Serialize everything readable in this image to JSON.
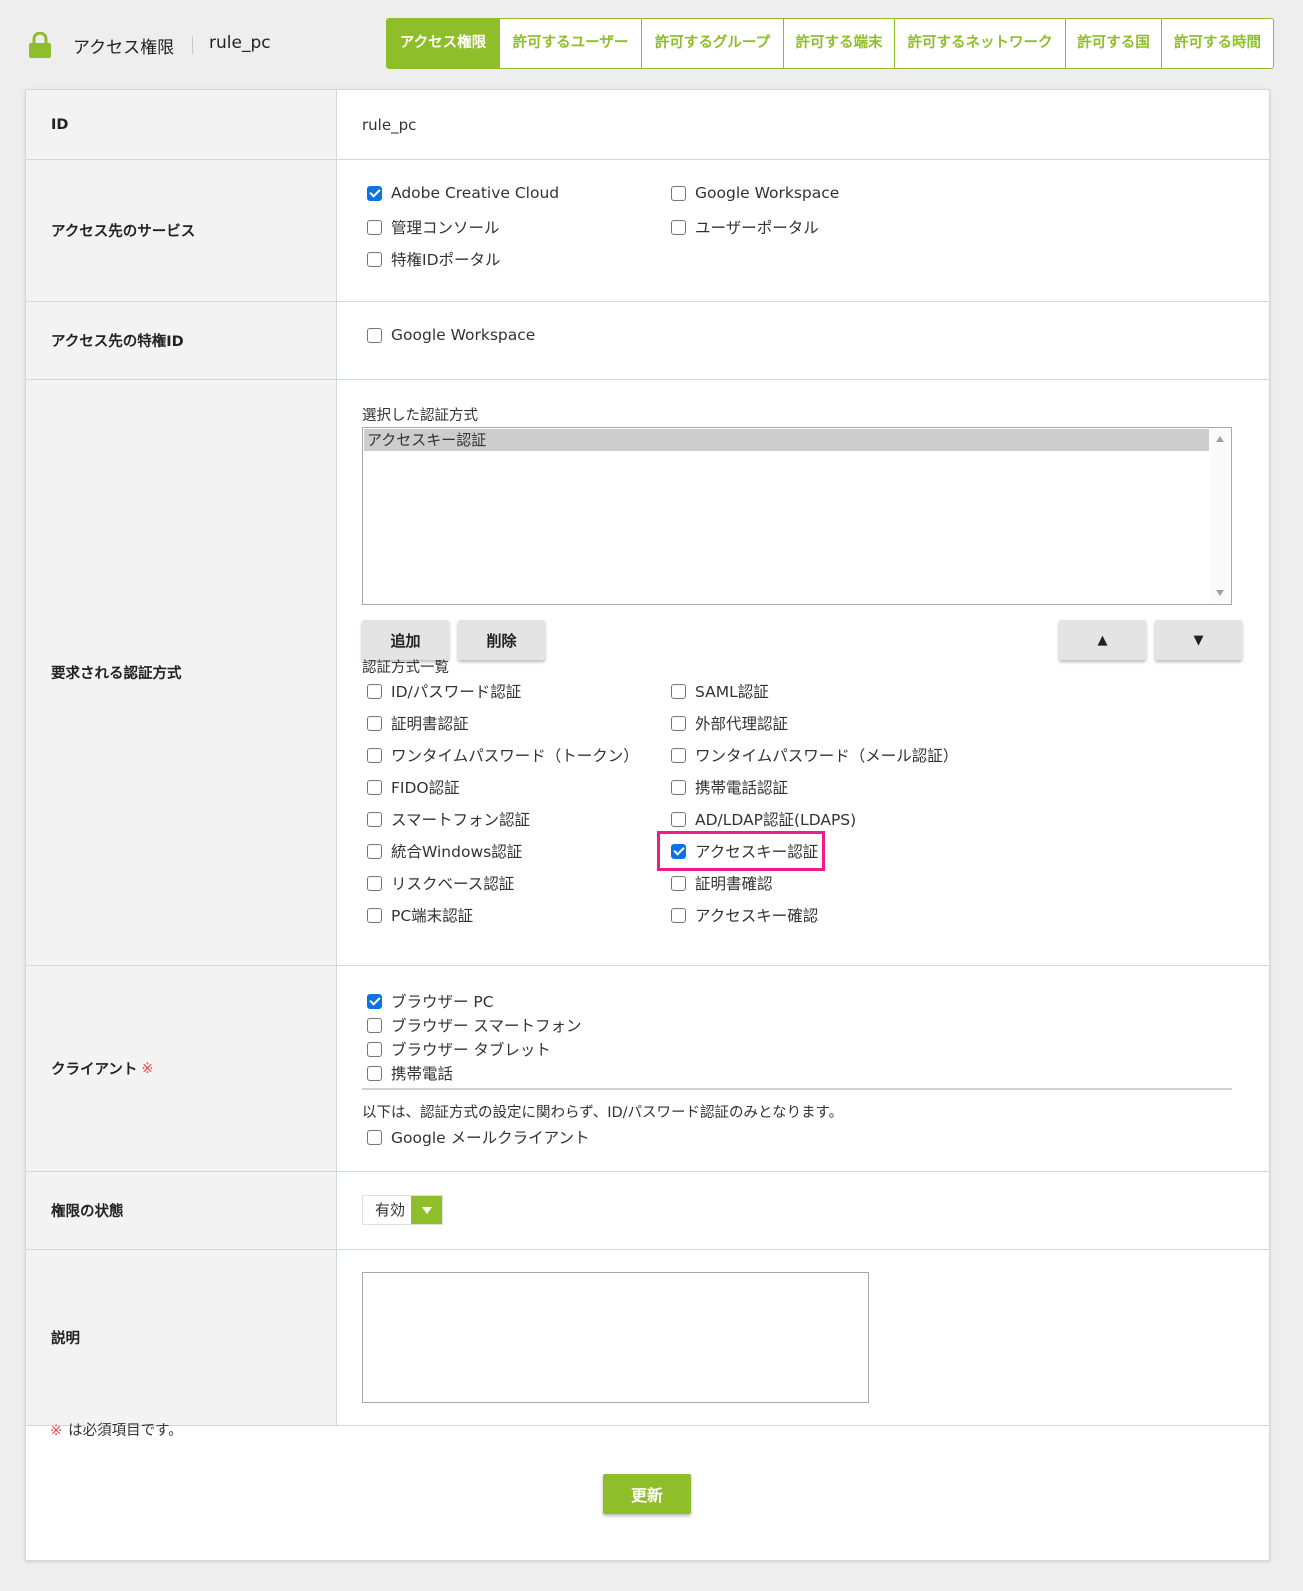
{
  "header": {
    "icon": "lock-icon",
    "accent_color": "#8fbe2b",
    "title": "アクセス権限",
    "rule_id": "rule_pc",
    "tabs": [
      {
        "label": "アクセス権限",
        "active": true
      },
      {
        "label": "許可するユーザー",
        "active": false
      },
      {
        "label": "許可するグループ",
        "active": false
      },
      {
        "label": "許可する端末",
        "active": false
      },
      {
        "label": "許可するネットワーク",
        "active": false
      },
      {
        "label": "許可する国",
        "active": false
      },
      {
        "label": "許可する時間",
        "active": false
      }
    ]
  },
  "form": {
    "id": {
      "label": "ID",
      "value": "rule_pc"
    },
    "services": {
      "label": "アクセス先のサービス",
      "options": [
        {
          "label": "Adobe Creative Cloud",
          "checked": true
        },
        {
          "label": "Google Workspace",
          "checked": false
        },
        {
          "label": "管理コンソール",
          "checked": false
        },
        {
          "label": "ユーザーポータル",
          "checked": false
        },
        {
          "label": "特権IDポータル",
          "checked": false
        }
      ]
    },
    "privileged_ids": {
      "label": "アクセス先の特権ID",
      "options": [
        {
          "label": "Google Workspace",
          "checked": false
        }
      ]
    },
    "auth_methods": {
      "label": "要求される認証方式",
      "selected_label": "選択した認証方式",
      "selected": [
        "アクセスキー認証"
      ],
      "add_button": "追加",
      "delete_button": "削除",
      "up_button": "▲",
      "down_button": "▼",
      "list_label": "認証方式一覧",
      "options": [
        {
          "label": "ID/パスワード認証",
          "checked": false
        },
        {
          "label": "SAML認証",
          "checked": false
        },
        {
          "label": "証明書認証",
          "checked": false
        },
        {
          "label": "外部代理認証",
          "checked": false
        },
        {
          "label": "ワンタイムパスワード（トークン）",
          "checked": false
        },
        {
          "label": "ワンタイムパスワード（メール認証）",
          "checked": false
        },
        {
          "label": "FIDO認証",
          "checked": false
        },
        {
          "label": "携帯電話認証",
          "checked": false
        },
        {
          "label": "スマートフォン認証",
          "checked": false
        },
        {
          "label": "AD/LDAP認証(LDAPS)",
          "checked": false
        },
        {
          "label": "統合Windows認証",
          "checked": false
        },
        {
          "label": "アクセスキー認証",
          "checked": true
        },
        {
          "label": "リスクベース認証",
          "checked": false
        },
        {
          "label": "証明書確認",
          "checked": false
        },
        {
          "label": "PC端末認証",
          "checked": false
        },
        {
          "label": "アクセスキー確認",
          "checked": false
        }
      ]
    },
    "client": {
      "label": "クライアント",
      "required_mark": "※",
      "options": [
        {
          "label": "ブラウザー PC",
          "checked": true
        },
        {
          "label": "ブラウザー スマートフォン",
          "checked": false
        },
        {
          "label": "ブラウザー タブレット",
          "checked": false
        },
        {
          "label": "携帯電話",
          "checked": false
        }
      ],
      "note": "以下は、認証方式の設定に関わらず、ID/パスワード認証のみとなります。",
      "extra_options": [
        {
          "label": "Google メールクライアント",
          "checked": false
        }
      ]
    },
    "status": {
      "label": "権限の状態",
      "value": "有効"
    },
    "description": {
      "label": "説明",
      "value": ""
    }
  },
  "footer": {
    "required_mark": "※",
    "required_note": "は必須項目です。",
    "submit_label": "更新"
  },
  "highlight_color": "#ee1b8a"
}
